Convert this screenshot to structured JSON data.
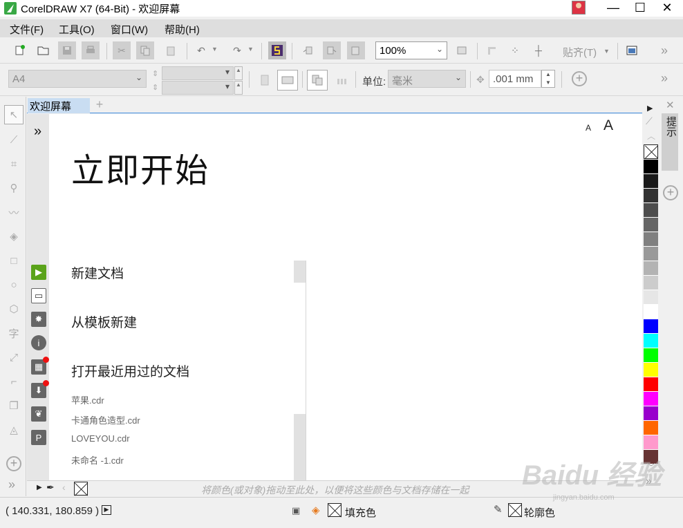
{
  "app": {
    "title": "CorelDRAW X7 (64-Bit) - 欢迎屏幕",
    "window": {
      "minimize": "—",
      "maximize": "☐",
      "close": "✕"
    }
  },
  "menu": [
    "文件(F)",
    "工具(O)",
    "窗口(W)",
    "帮助(H)"
  ],
  "toolbar1": {
    "zoom": "100%",
    "snap_label": "贴齐(T)",
    "more": "»"
  },
  "toolbar2": {
    "page_size": "A4",
    "unit_label": "单位:",
    "unit_value": "毫米",
    "nudge": ".001 mm",
    "more": "»"
  },
  "tab": {
    "label": "欢迎屏幕",
    "add": "+"
  },
  "welcome": {
    "expand": "»",
    "font_small": "A",
    "font_large": "A",
    "heading": "立即开始",
    "nav": [
      "新建文档",
      "从模板新建",
      "打开最近用过的文档"
    ],
    "recent_files": [
      "苹果.cdr",
      "卡通角色造型.cdr",
      "LOVEYOU.cdr",
      "未命名 -1.cdr"
    ]
  },
  "palette_colors": [
    "#000000",
    "#1a1a1a",
    "#333333",
    "#4d4d4d",
    "#666666",
    "#808080",
    "#999999",
    "#b3b3b3",
    "#cccccc",
    "#e6e6e6",
    "#ffffff",
    "#0000ff",
    "#00ffff",
    "#00ff00",
    "#ffff00",
    "#ff0000",
    "#ff00ff",
    "#9900cc",
    "#ff6600",
    "#ff99cc",
    "#663333"
  ],
  "docker": {
    "label": "提示"
  },
  "doc_palette": {
    "drop_hint": "将颜色(或对象)拖动至此处，以便将这些颜色与文档存储在一起"
  },
  "status": {
    "coords": "( 140.331, 180.859 )",
    "fill_label": "填充色",
    "outline_label": "轮廓色"
  },
  "watermark": {
    "brand": "Baidu 经验",
    "url": "jingyan.baidu.com"
  }
}
